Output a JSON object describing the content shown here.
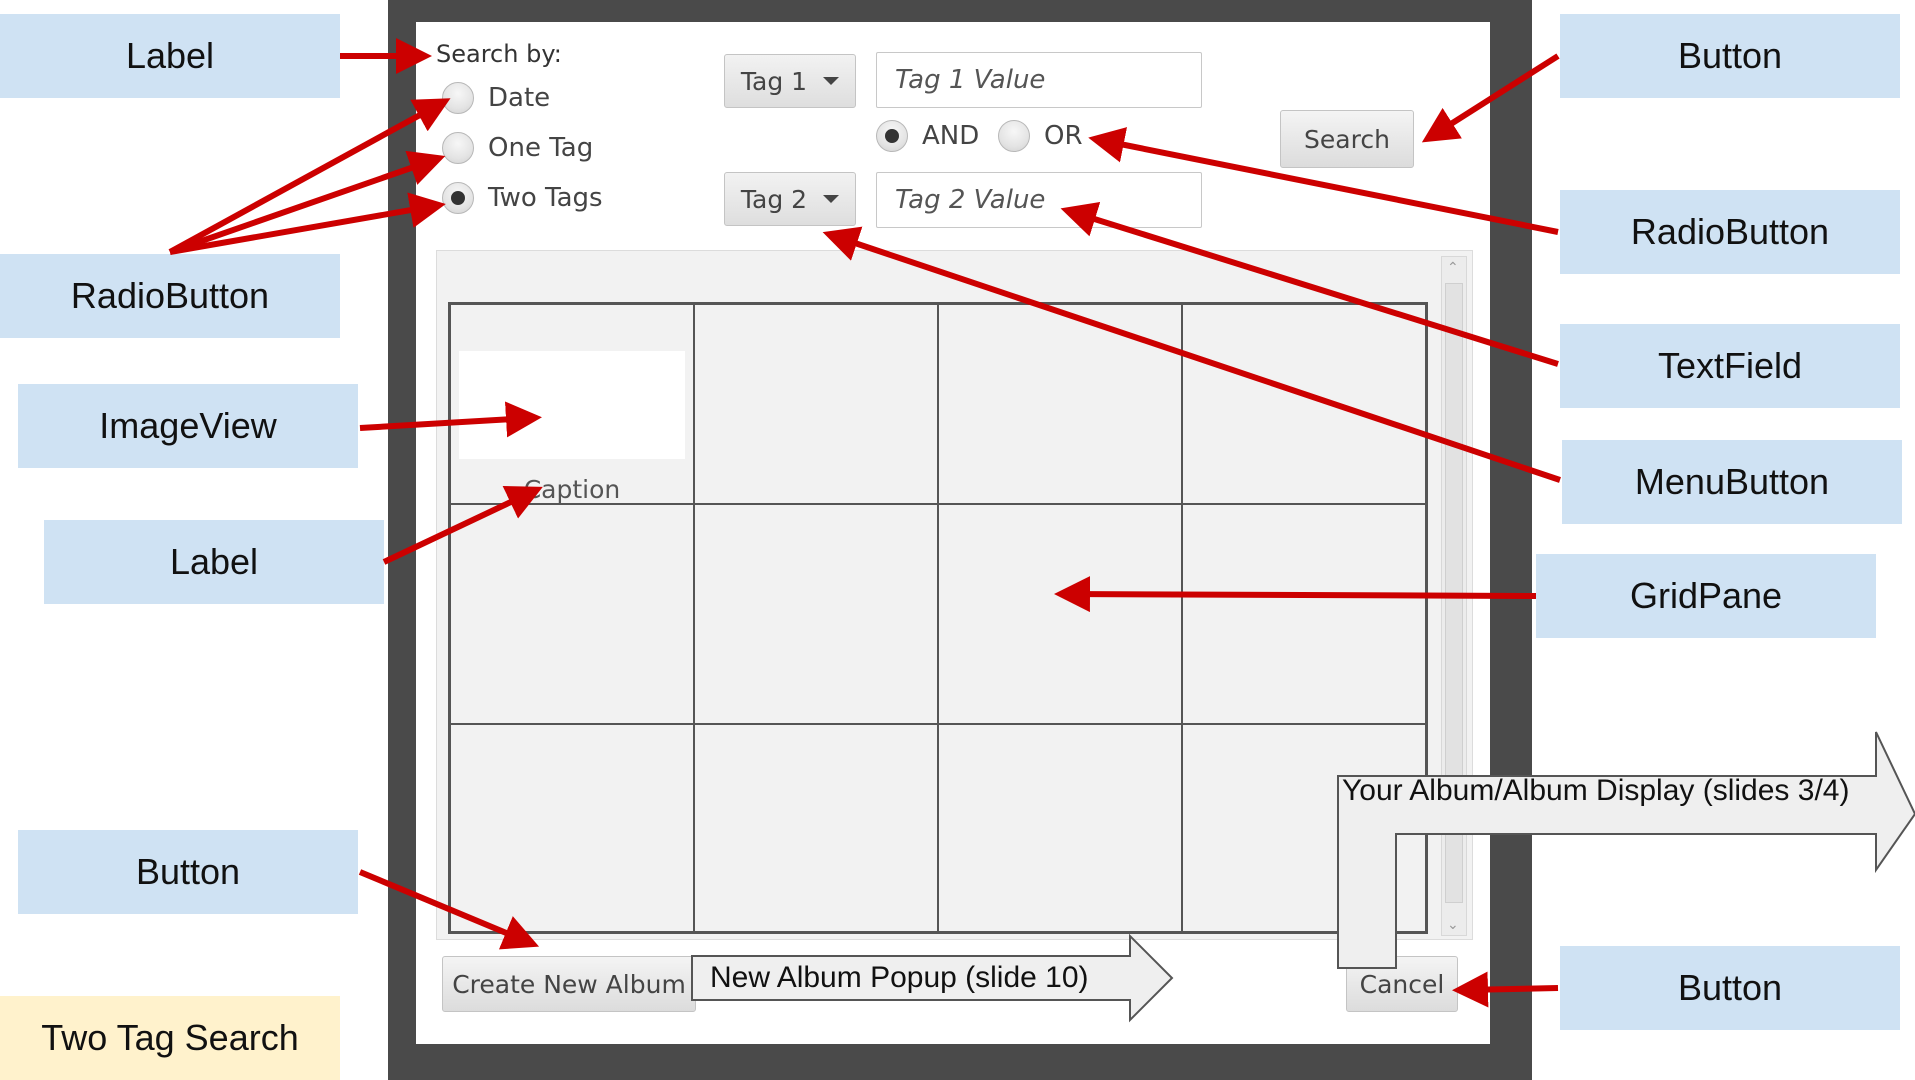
{
  "slide": {
    "title": "Two Tag Search"
  },
  "dialog": {
    "search_by_label": "Search by:",
    "radios": [
      {
        "label": "Date",
        "checked": false
      },
      {
        "label": "One Tag",
        "checked": false
      },
      {
        "label": "Two Tags",
        "checked": true
      }
    ],
    "tag1_menu_label": "Tag 1",
    "tag1_placeholder": "Tag 1 Value",
    "tag2_menu_label": "Tag 2",
    "tag2_placeholder": "Tag 2 Value",
    "logic_radios": [
      {
        "label": "AND",
        "checked": true
      },
      {
        "label": "OR",
        "checked": false
      }
    ],
    "search_button": "Search",
    "caption": "Caption",
    "create_album_button": "Create New Album",
    "cancel_button": "Cancel"
  },
  "callouts": {
    "label_top": "Label",
    "radio_left": "RadioButton",
    "imageview": "ImageView",
    "label_caption": "Label",
    "button_left": "Button",
    "button_top_right": "Button",
    "radio_right": "RadioButton",
    "textfield": "TextField",
    "menubutton": "MenuButton",
    "gridpane": "GridPane",
    "button_bottom_right": "Button"
  },
  "navigation": {
    "album_display": "Your Album/Album Display (slides 3/4)",
    "new_album_popup": "New Album Popup (slide 10)"
  },
  "colors": {
    "callout_bg": "#cfe2f3",
    "title_bg": "#fff2cc",
    "arrow": "#cc0000",
    "frame": "#4a4a4a"
  }
}
